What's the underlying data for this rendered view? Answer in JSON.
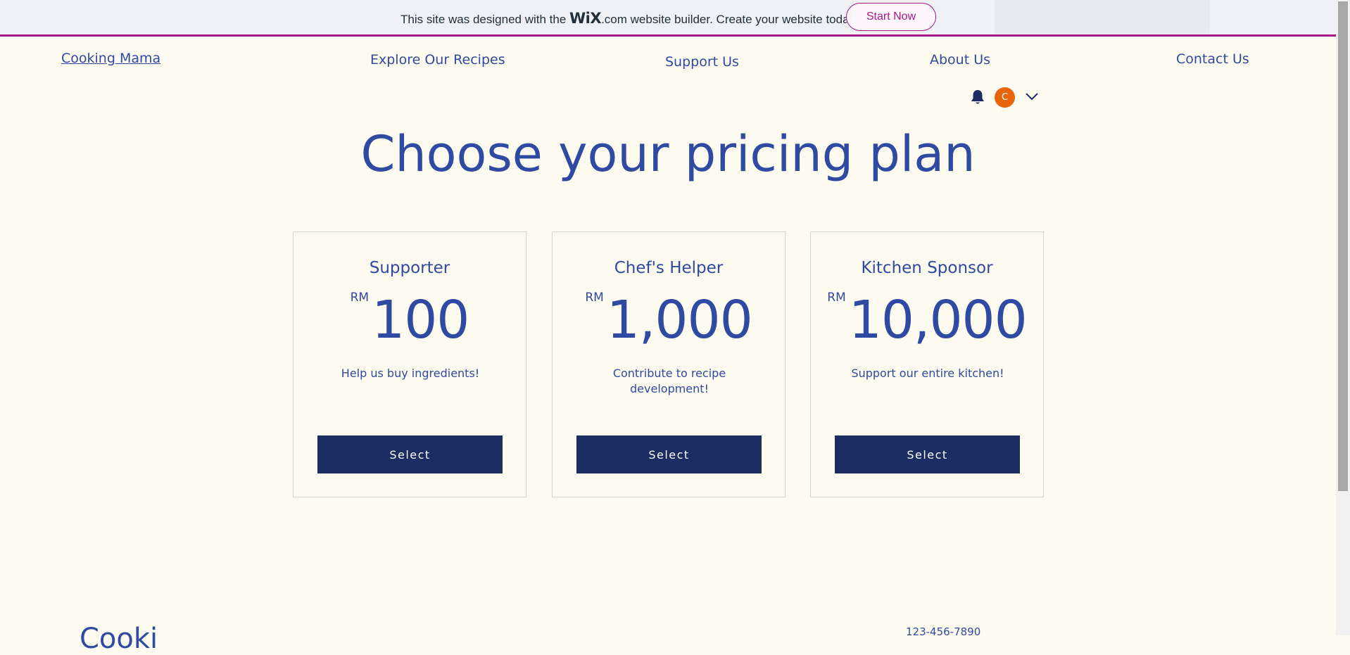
{
  "banner": {
    "text_before": "This site was designed with the ",
    "logo": "WiX",
    "text_after": ".com website builder. Create your website today.",
    "cta_label": "Start Now",
    "accent_color": "#a8168b"
  },
  "nav": {
    "brand": "Cooking Mama",
    "items": [
      {
        "label": "Explore Our Recipes"
      },
      {
        "label": "Support Us"
      },
      {
        "label": "About Us"
      },
      {
        "label": "Contact Us"
      }
    ]
  },
  "user": {
    "avatar_initial": "C",
    "avatar_color": "#e8650c",
    "icons": [
      "bell-icon",
      "chevron-down-icon"
    ]
  },
  "page": {
    "title": "Choose your pricing plan"
  },
  "plans": [
    {
      "name": "Supporter",
      "currency": "RM",
      "price": "100",
      "description": "Help us buy ingredients!",
      "button_label": "Select"
    },
    {
      "name": "Chef's Helper",
      "currency": "RM",
      "price": "1,000",
      "description": "Contribute to recipe development!",
      "button_label": "Select"
    },
    {
      "name": "Kitchen Sponsor",
      "currency": "RM",
      "price": "10,000",
      "description": "Support our entire kitchen!",
      "button_label": "Select"
    }
  ],
  "footer": {
    "brand_partial": "Cooki",
    "phone_partial": "123-456-7890"
  },
  "theme": {
    "background": "#fdfaf0",
    "text_blue": "#2e4aa3",
    "button_navy": "#1b2d62"
  }
}
